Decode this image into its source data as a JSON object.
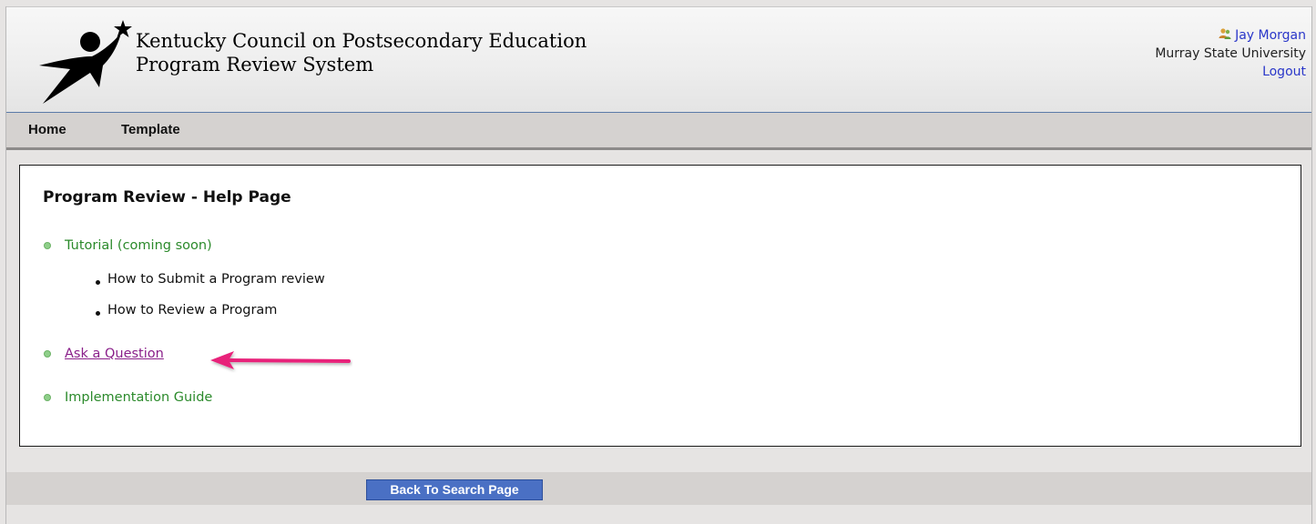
{
  "header": {
    "title_line1": "Kentucky Council on Postsecondary Education",
    "title_line2": "Program Review System",
    "user_name": "Jay Morgan",
    "user_org": "Murray State University",
    "logout": "Logout"
  },
  "nav": {
    "items": [
      {
        "label": "Home"
      },
      {
        "label": "Template"
      }
    ]
  },
  "main": {
    "heading": "Program Review - Help Page",
    "tutorial": "Tutorial (coming soon)",
    "sub_items": [
      {
        "label": "How to Submit a Program review"
      },
      {
        "label": "How to Review a Program"
      }
    ],
    "ask": "Ask a Question",
    "guide": "Implementation Guide"
  },
  "footer": {
    "back_button": "Back To Search Page"
  },
  "colors": {
    "link_blue": "#2a37c9",
    "green_text": "#2b8a2b",
    "visited_link": "#8a1f8a",
    "arrow": "#e8207a",
    "header_rule": "#5b7aa8",
    "button_blue": "#4a70c4"
  },
  "icons": {
    "logo": "star-person-logo",
    "user": "users-icon",
    "annotation": "pink-arrow"
  }
}
